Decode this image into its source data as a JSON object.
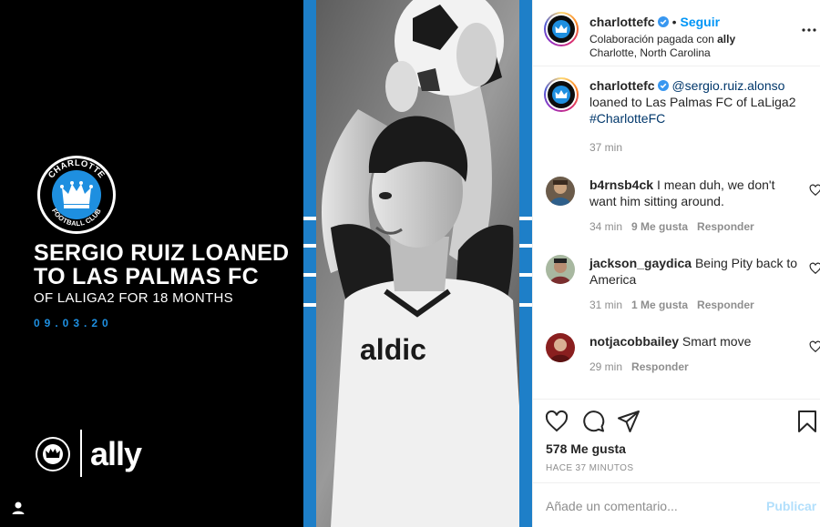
{
  "image": {
    "headline": "SERGIO RUIZ LOANED TO LAS PALMAS FC",
    "subheadline": "OF LALIGA2 FOR 18 MONTHS",
    "date": "09.03.20",
    "crest_top": "CHARLOTTE",
    "crest_bottom": "FOOTBALL CLUB",
    "sponsor": "ally",
    "jersey_text": "aldic",
    "colors": {
      "stripe": "#1e7fc8",
      "date": "#1e8fe0",
      "crest": "#1e8fe0"
    }
  },
  "header": {
    "username": "charlottefc",
    "dot": "•",
    "follow_label": "Seguir",
    "collab_prefix": "Colaboración pagada con",
    "collab_partner": "ally",
    "location": "Charlotte, North Carolina"
  },
  "caption": {
    "username": "charlottefc",
    "mention": "@sergio.ruiz.alonso",
    "text": "loaned to Las Palmas FC of LaLiga2",
    "hashtag": "#CharlotteFC",
    "time": "37 min"
  },
  "comments": [
    {
      "username": "b4rnsb4ck",
      "text": "I mean duh, we don't want him sitting around.",
      "time": "34 min",
      "likes": "9 Me gusta",
      "reply": "Responder"
    },
    {
      "username": "jackson_gaydica",
      "text": "Being Pity back to America",
      "time": "31 min",
      "likes": "1 Me gusta",
      "reply": "Responder"
    },
    {
      "username": "notjacobbailey",
      "text": "Smart move",
      "time": "29 min",
      "likes": "",
      "reply": "Responder"
    }
  ],
  "actions": {
    "likes": "578 Me gusta",
    "time_ago": "HACE 37 MINUTOS"
  },
  "add_comment": {
    "placeholder": "Añade un comentario...",
    "post_label": "Publicar"
  },
  "icons": [
    "heart-icon",
    "comment-icon",
    "share-icon",
    "bookmark-icon",
    "more-icon",
    "verified-icon",
    "user-tag-icon"
  ]
}
